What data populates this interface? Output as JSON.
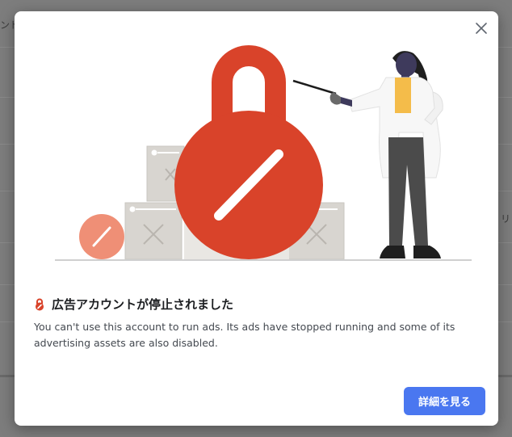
{
  "background": {
    "left_fragment": "ンド",
    "right_fragment": "リ"
  },
  "dialog": {
    "title": "広告アカウントが停止されました",
    "body": "You can't use this account to run ads. Its ads have stopped running and some of its advertising assets are also disabled.",
    "cta_label": "詳細を見る"
  },
  "colors": {
    "accent": "#4a77f0",
    "alert_red": "#d9432a",
    "soft_red": "#ef8f76"
  },
  "icons": {
    "close": "close-icon",
    "title": "lock-alert-icon"
  }
}
